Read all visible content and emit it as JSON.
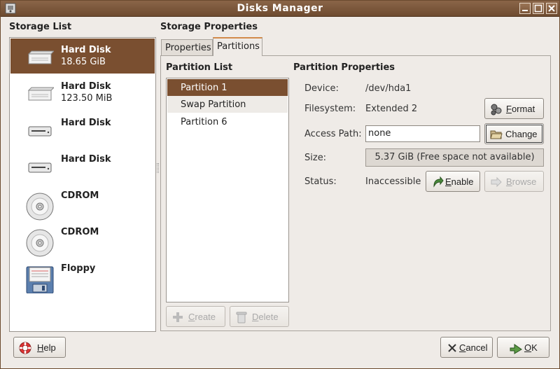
{
  "window": {
    "title": "Disks Manager"
  },
  "storage": {
    "heading": "Storage List",
    "items": [
      {
        "name": "Hard Disk",
        "size": "18.65 GiB",
        "icon": "hard-disk-icon"
      },
      {
        "name": "Hard Disk",
        "size": "123.50 MiB",
        "icon": "hard-disk-icon"
      },
      {
        "name": "Hard Disk",
        "size": "",
        "icon": "hard-disk-small-icon"
      },
      {
        "name": "Hard Disk",
        "size": "",
        "icon": "hard-disk-small-icon"
      },
      {
        "name": "CDROM",
        "size": "",
        "icon": "cdrom-icon"
      },
      {
        "name": "CDROM",
        "size": "",
        "icon": "cdrom-icon"
      },
      {
        "name": "Floppy",
        "size": "",
        "icon": "floppy-icon"
      }
    ]
  },
  "properties": {
    "heading": "Storage Properties",
    "tabs": [
      "Properties",
      "Partitions"
    ],
    "active_tab": "Partitions"
  },
  "partitions": {
    "heading": "Partition List",
    "items": [
      "Partition 1",
      "Swap Partition",
      "Partition 6"
    ],
    "create": {
      "pre": "",
      "u": "C",
      "post": "reate"
    },
    "delete": {
      "pre": "",
      "u": "D",
      "post": "elete"
    }
  },
  "partition_props": {
    "heading": "Partition Properties",
    "device_label": "Device:",
    "device_value": "/dev/hda1",
    "filesystem_label": "Filesystem:",
    "filesystem_value": "Extended 2",
    "format": {
      "pre": "",
      "u": "F",
      "post": "ormat"
    },
    "access_label": "Access Path:",
    "access_value": "none",
    "change_label": "Change",
    "size_label": "Size:",
    "size_value": "5.37 GiB (Free space not available)",
    "status_label": "Status:",
    "status_value": "Inaccessible",
    "enable": {
      "pre": "",
      "u": "E",
      "post": "nable"
    },
    "browse": {
      "pre": "",
      "u": "B",
      "post": "rowse"
    }
  },
  "footer": {
    "help": {
      "pre": "",
      "u": "H",
      "post": "elp"
    },
    "cancel": {
      "pre": "",
      "u": "C",
      "post": "ancel"
    },
    "ok": {
      "pre": "",
      "u": "O",
      "post": "K"
    }
  },
  "colors": {
    "accent": "#7a4f30",
    "titlebar": "#7a5539",
    "tab_highlight": "#d28b4b"
  }
}
